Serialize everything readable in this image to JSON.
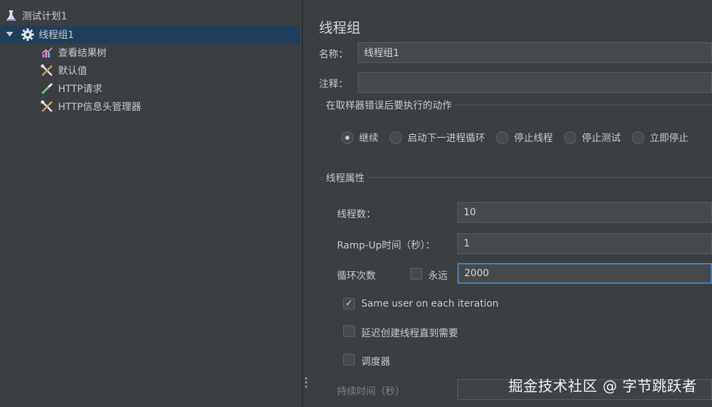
{
  "tree": {
    "items": [
      {
        "label": "测试计划1",
        "icon": "flask-icon"
      },
      {
        "label": "线程组1",
        "icon": "gear-icon"
      },
      {
        "label": "查看结果树",
        "icon": "chart-icon"
      },
      {
        "label": "默认值",
        "icon": "wrench-scissors-icon"
      },
      {
        "label": "HTTP请求",
        "icon": "pipette-icon"
      },
      {
        "label": "HTTP信息头管理器",
        "icon": "wrench-scissors-icon"
      }
    ]
  },
  "panel": {
    "title": "线程组",
    "name_label": "名称：",
    "name_value": "线程组1",
    "comment_label": "注释：",
    "comment_value": "",
    "error_section_title": "在取样器错误后要执行的动作",
    "error_actions": [
      {
        "label": "继续",
        "checked": true
      },
      {
        "label": "启动下一进程循环",
        "checked": false
      },
      {
        "label": "停止线程",
        "checked": false
      },
      {
        "label": "停止测试",
        "checked": false
      },
      {
        "label": "立即停止",
        "checked": false
      }
    ],
    "thread_section_title": "线程属性",
    "threads_label": "线程数：",
    "threads_value": "10",
    "rampup_label": "Ramp-Up时间（秒）：",
    "rampup_value": "1",
    "loop_label": "循环次数",
    "forever_label": "永远",
    "forever_checked": false,
    "loop_value": "2000",
    "same_user_label": "Same user on each iteration",
    "same_user_checked": true,
    "delay_label": "延迟创建线程直到需要",
    "delay_checked": false,
    "scheduler_label": "调度器",
    "scheduler_checked": false,
    "duration_label": "持续时间（秒）",
    "duration_value": ""
  },
  "watermark": "掘金技术社区 @ 字节跳跃者",
  "colors": {
    "background": "#3b3f42",
    "selection": "#1f3f5d",
    "focus_border": "#4a7fb5",
    "text": "#c8cbcd"
  }
}
